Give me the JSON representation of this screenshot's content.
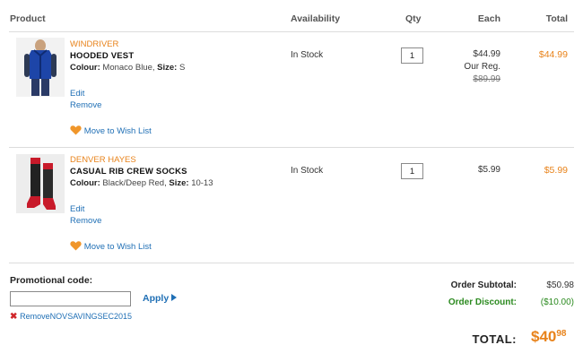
{
  "columns": {
    "product": "Product",
    "availability": "Availability",
    "qty": "Qty",
    "each": "Each",
    "total": "Total"
  },
  "items": [
    {
      "brand": "WINDRIVER",
      "name": "HOODED VEST",
      "colour_label": "Colour:",
      "colour": "Monaco Blue",
      "size_label": "Size:",
      "size": "S",
      "availability": "In Stock",
      "qty": "1",
      "each": "$44.99",
      "reg_label": "Our Reg.",
      "reg_price": "$89.99",
      "total": "$44.99",
      "edit": "Edit",
      "remove": "Remove",
      "wishlist": "Move to Wish List"
    },
    {
      "brand": "DENVER HAYES",
      "name": "CASUAL RIB CREW SOCKS",
      "colour_label": "Colour:",
      "colour": "Black/Deep Red",
      "size_label": "Size:",
      "size": "10-13",
      "availability": "In Stock",
      "qty": "1",
      "each": "$5.99",
      "total": "$5.99",
      "edit": "Edit",
      "remove": "Remove",
      "wishlist": "Move to Wish List"
    }
  ],
  "promo": {
    "label": "Promotional code:",
    "value": "",
    "apply": "Apply",
    "applied_code": "RemoveNOVSAVINGSEC2015"
  },
  "summary": {
    "subtotal_label": "Order Subtotal:",
    "subtotal": "$50.98",
    "discount_label": "Order Discount:",
    "discount": "($10.00)",
    "total_label": "TOTAL:",
    "total_dollars": "$40",
    "total_cents": "98"
  },
  "colors": {
    "accent": "#e8831b",
    "link": "#1f6fb5",
    "discount": "#2b8a1f"
  }
}
